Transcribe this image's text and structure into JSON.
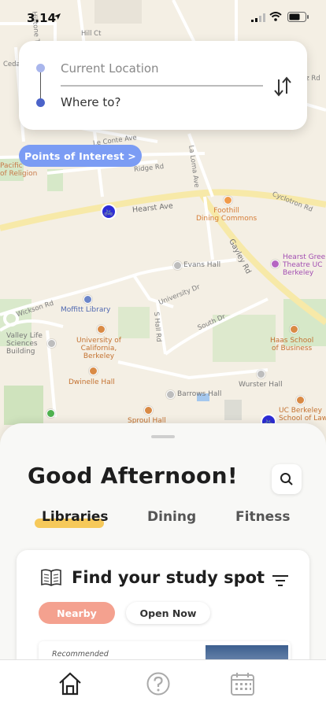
{
  "status_bar": {
    "time": "3.14"
  },
  "route": {
    "from_placeholder": "Current Location",
    "to_placeholder": "Where to?"
  },
  "points_of_interest": {
    "label": "Points of Interest  >"
  },
  "map": {
    "streets": {
      "hill_ct": "Hill Ct",
      "le_conte": "Le Conte Ave",
      "ridge": "Ridge Rd",
      "hearst": "Hearst Ave",
      "la_loma": "La Loma Ave",
      "gayley": "Gayley Rd",
      "cyclotron": "Cyclotron Rd",
      "university_dr": "University Dr",
      "wickson": "Wickson Rd",
      "south_dr": "South Dr",
      "s_hall": "S Hall Rd",
      "hearst_rd_partial": "ez Rd",
      "cedar_partial": "Ceda",
      "hill_partial": "Hilltone T"
    },
    "places": {
      "pacific": "Pacific\nof Religion",
      "foothill": "Foothill\nDining Commons",
      "hearst_greek": "Hearst Gree\nTheatre UC\nBerkeley",
      "evans": "Evans Hall",
      "moffitt": "Moffitt Library",
      "valley": "Valley Life\nSciences\nBuilding",
      "uc_berkeley": "University of\nCalifornia,\nBerkeley",
      "haas": "Haas School\nof Business",
      "dwinelle": "Dwinelle Hall",
      "wurster": "Wurster Hall",
      "barrows": "Barrows Hall",
      "uc_law": "UC Berkeley\nSchool of Law",
      "sproul": "Sproul Hall"
    }
  },
  "sheet": {
    "greeting": "Good Afternoon!",
    "tabs": {
      "libraries": "Libraries",
      "dining": "Dining",
      "fitness": "Fitness"
    },
    "study_card": {
      "title": "Find your study spot",
      "chips": {
        "nearby": "Nearby",
        "open_now": "Open Now"
      },
      "recommended_label": "Recommended"
    }
  },
  "colors": {
    "accent_blue": "#7b9cf4",
    "tab_underline": "#f6c95a",
    "nearby_chip": "#f4a18f"
  },
  "icons": {
    "home": "home-icon",
    "help": "question-icon",
    "calendar": "calendar-icon"
  }
}
